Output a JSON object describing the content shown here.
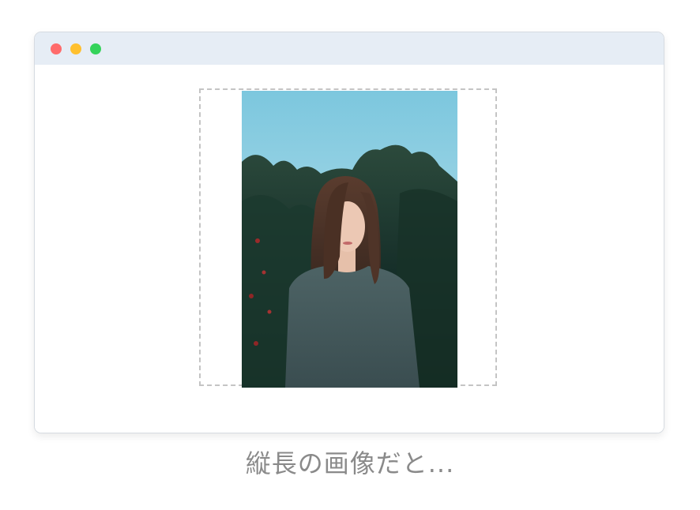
{
  "window": {
    "traffic_lights": {
      "close_color": "#ff6b6b",
      "minimize_color": "#ffc02e",
      "maximize_color": "#34d35a"
    }
  },
  "image": {
    "orientation": "portrait",
    "subject": "woman-portrait-photo"
  },
  "caption": "縦長の画像だと..."
}
